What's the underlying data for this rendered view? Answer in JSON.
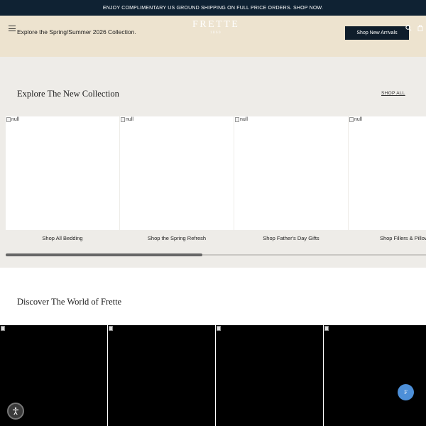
{
  "announcement": "ENJOY COMPLIMENTARY US GROUND SHIPPING ON FULL PRICE ORDERS. SHOP NOW.",
  "header": {
    "promo_text": "Explore the Spring/Summer 2026 Collection.",
    "logo_word": "FRETTE",
    "logo_year": "1860",
    "cta_label": "Shop New Arrivals",
    "icons": [
      "menu-icon",
      "search-icon",
      "bag-icon"
    ]
  },
  "collection": {
    "title": "Explore The New Collection",
    "shop_all": "SHOP ALL",
    "cards": [
      {
        "alt": "null",
        "caption": "Shop All Bedding"
      },
      {
        "alt": "null",
        "caption": "Shop the Spring Refresh"
      },
      {
        "alt": "null",
        "caption": "Shop Father's Day Gifts"
      },
      {
        "alt": "null",
        "caption": "Shop Fillers & Pillows"
      }
    ]
  },
  "discover": {
    "title": "Discover The World of Frette"
  },
  "widgets": {
    "chat_label": "F",
    "accessibility_icon": "accessibility-icon"
  },
  "colors": {
    "announcement_bg": "#0f2233",
    "header_bg": "#ede3cf",
    "section_bg": "#eeece8",
    "cta_bg": "#0f1d2b",
    "chat_bg": "#4d8fd8"
  }
}
